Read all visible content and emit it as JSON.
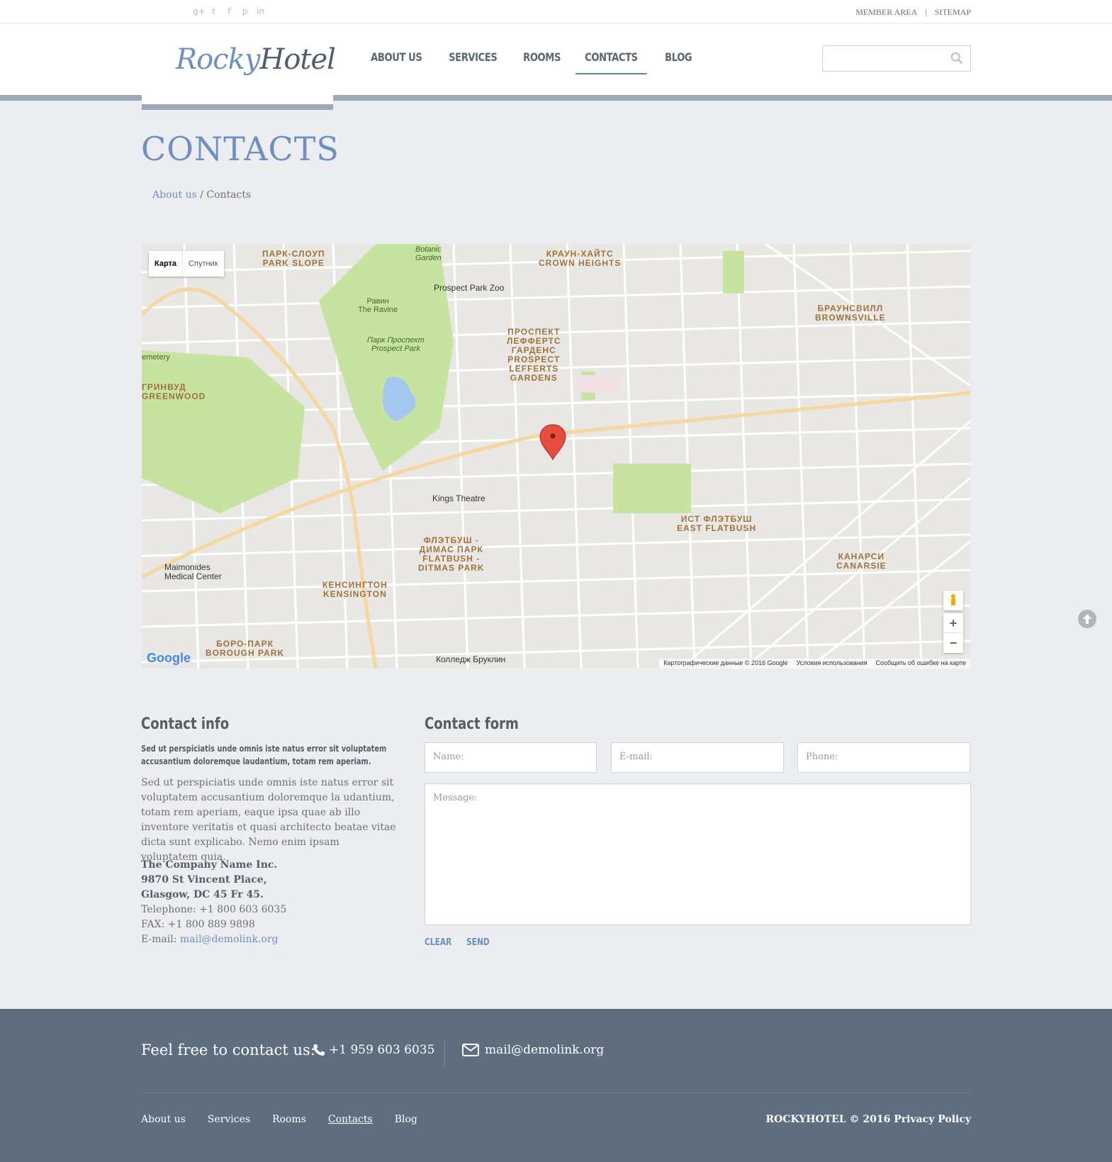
{
  "topbar": {
    "social": [
      "google-plus-icon",
      "twitter-icon",
      "facebook-icon",
      "pinterest-icon",
      "linkedin-icon"
    ],
    "links": [
      "MEMBER AREA",
      "SITEMAP"
    ],
    "separator": "|"
  },
  "header": {
    "logo_part1": "Rocky",
    "logo_part2": "Hotel",
    "nav": [
      "ABOUT US",
      "SERVICES",
      "ROOMS",
      "CONTACTS",
      "BLOG"
    ],
    "active_nav": "CONTACTS",
    "search_placeholder": ""
  },
  "page": {
    "title": "CONTACTS",
    "breadcrumb_link": "About us",
    "breadcrumb_sep": "/",
    "breadcrumb_current": "Contacts"
  },
  "map": {
    "type_map": "Карта",
    "type_satellite": "Спутник",
    "attribution": "Картографические данные © 2016 Google",
    "terms": "Условия использования",
    "report": "Сообщить об ошибке на карте",
    "google": "Google",
    "zoom_in": "+",
    "zoom_out": "−",
    "labels": {
      "park_slope": "ПАРК-СЛОУП\nPARK SLOPE",
      "crown_heights": "КРАУН-ХАЙТС\nCROWN HEIGHTS",
      "brownsville": "БРАУНСВИЛЛ\nBROWNSVILLE",
      "lefferts": "ПРОСПЕКТ\nЛЕФФЕРТС\nГАРДЕНС\nPROSPECT\nLEFFERTS\nGARDENS",
      "greenwood": "ГРИНВУД\nGREENWOOD",
      "east_flatbush": "ИСТ ФЛЭТБУШ\nEAST FLATBUSH",
      "flatbush": "ФЛЭТБУШ -\nДИМАС ПАРК\nFLATBUSH -\nDITMAS PARK",
      "kensington": "КЕНСИНГТОН\nKENSINGTON",
      "canarsie": "КАНАРСИ\nCANARSIE",
      "borough_park": "БОРО-ПАРК\nBOROUGH PARK",
      "prospect_park_zoo": "Prospect Park Zoo",
      "kings_theatre": "Kings Theatre",
      "maimonides": "Maimonides\nMedical Center",
      "college": "Колледж Бруклин",
      "park_prospect": "Парк Проспект\nProspect Park",
      "ravine": "Равин\nThe Ravine",
      "botanic": "Botanic\nGarden",
      "cemetery": "emetery"
    }
  },
  "contact_info": {
    "title": "Contact info",
    "lead": "Sed ut perspiciatis unde omnis iste natus error sit voluptatem accusantium doloremque laudantium, totam rem aperiam.",
    "body": "Sed ut perspiciatis unde omnis iste natus error sit voluptatem accusantium doloremque la udantium, totam rem aperiam, eaque ipsa quae ab illo inventore veritatis et quasi architecto beatae vitae dicta sunt explicabo. Nemo enim ipsam voluptatem quia.",
    "company": "The Company Name Inc.",
    "address1": "9870 St Vincent Place,",
    "address2": "Glasgow, DC 45 Fr 45.",
    "telephone": "Telephone: +1 800 603 6035",
    "fax": "FAX: +1 800 889 9898",
    "email_label": "E-mail: ",
    "email": "mail@demolink.org"
  },
  "contact_form": {
    "title": "Contact form",
    "name_placeholder": "Name:",
    "email_placeholder": "E-mail:",
    "phone_placeholder": "Phone:",
    "message_placeholder": "Message:",
    "clear": "CLEAR",
    "send": "SEND"
  },
  "footer": {
    "cta": "Feel free to contact us:",
    "phone": "+1 959 603 6035",
    "email": "mail@demolink.org",
    "nav": [
      "About us",
      "Services",
      "Rooms",
      "Contacts",
      "Blog"
    ],
    "active_nav": "Contacts",
    "copyright": "ROCKYHOTEL © 2016 Privacy Policy"
  },
  "colors": {
    "accent": "#6f8fc0",
    "footer_bg": "#5e6d80",
    "page_bg": "#ebedf0"
  }
}
